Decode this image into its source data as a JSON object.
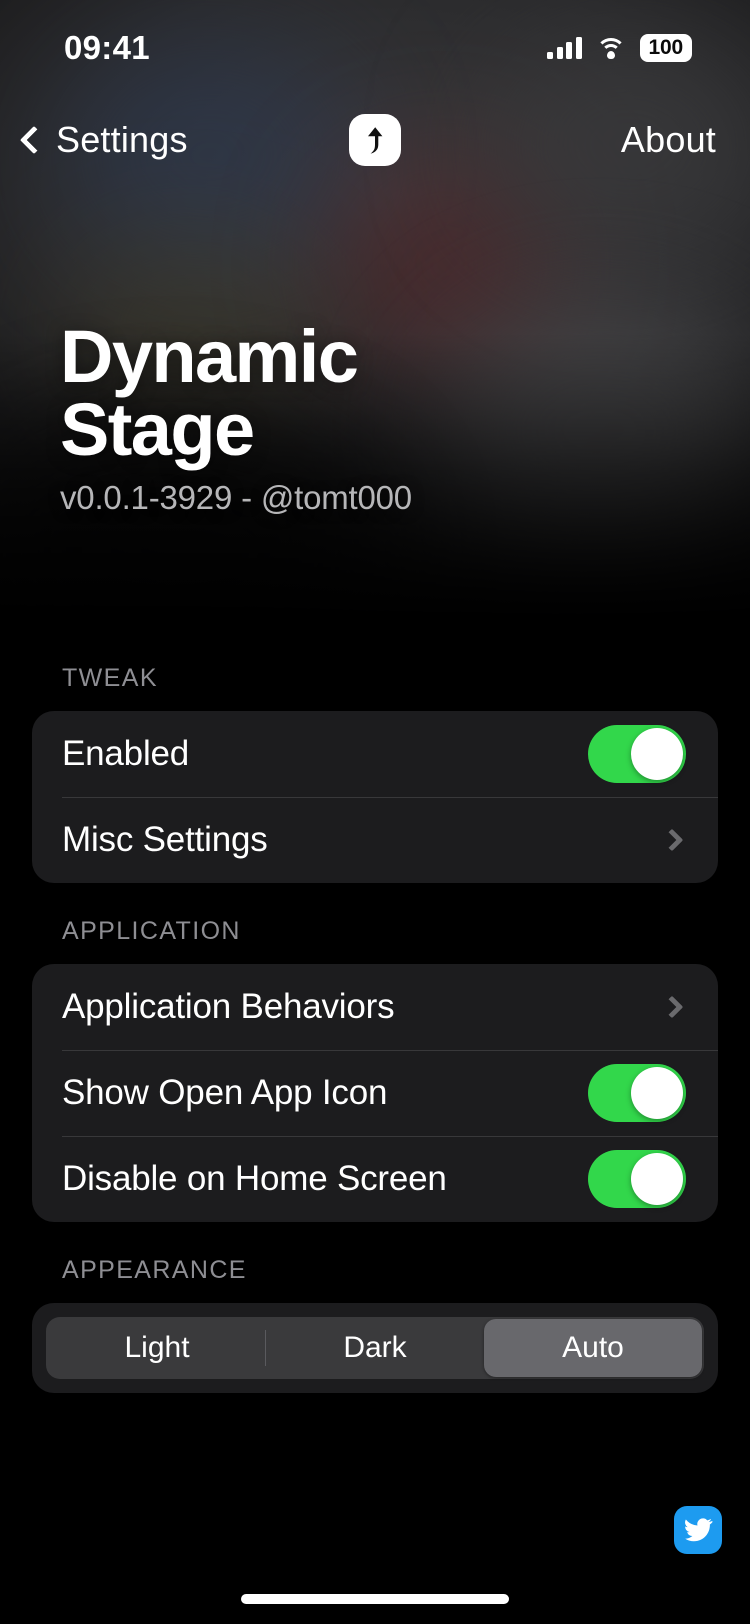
{
  "status_bar": {
    "time": "09:41",
    "signal_icon": "cellular-signal-icon",
    "wifi_icon": "wifi-icon",
    "battery_level": "100"
  },
  "nav_bar": {
    "back_label": "Settings",
    "back_icon": "chevron-left-icon",
    "logo_icon": "dynamic-stage-logo-icon",
    "right_label": "About"
  },
  "hero": {
    "title": "Dynamic Stage",
    "subtitle": "v0.0.1-3929 - @tomt000"
  },
  "sections": [
    {
      "header": "TWEAK",
      "rows": [
        {
          "label": "Enabled",
          "control": "toggle",
          "value": "on"
        },
        {
          "label": "Misc Settings",
          "control": "chevron"
        }
      ]
    },
    {
      "header": "APPLICATION",
      "rows": [
        {
          "label": "Application Behaviors",
          "control": "chevron"
        },
        {
          "label": "Show Open App Icon",
          "control": "toggle",
          "value": "on"
        },
        {
          "label": "Disable on Home Screen",
          "control": "toggle",
          "value": "on"
        }
      ]
    },
    {
      "header": "APPEARANCE",
      "segmented": {
        "options": [
          "Light",
          "Dark",
          "Auto"
        ],
        "selected": "Auto"
      }
    }
  ],
  "footer": {
    "twitter_icon": "twitter-bird-icon",
    "home_indicator": "home-indicator"
  },
  "colors": {
    "background": "#000000",
    "card": "#1c1c1e",
    "separator": "#38383a",
    "section_header_text": "#8e8e93",
    "toggle_on": "#32d74b",
    "segment_track": "#3a3a3c",
    "segment_selected": "#68686c",
    "twitter_blue": "#1d9bf0",
    "subtitle_text": "#b6b6b8",
    "chevron": "#6a6a6d"
  }
}
